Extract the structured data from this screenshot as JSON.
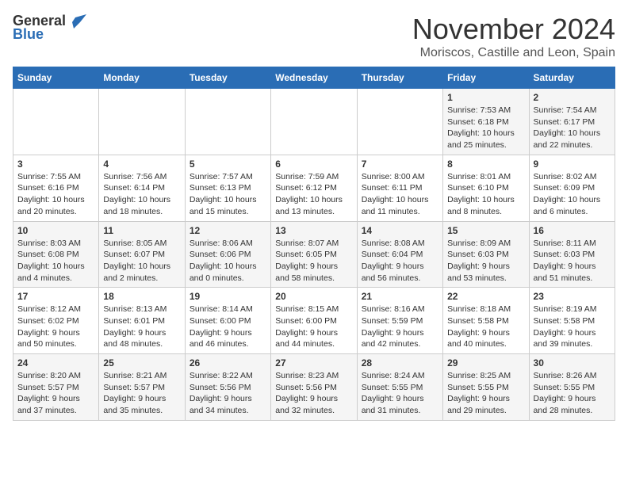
{
  "header": {
    "logo_general": "General",
    "logo_blue": "Blue",
    "month": "November 2024",
    "location": "Moriscos, Castille and Leon, Spain"
  },
  "days_of_week": [
    "Sunday",
    "Monday",
    "Tuesday",
    "Wednesday",
    "Thursday",
    "Friday",
    "Saturday"
  ],
  "weeks": [
    [
      {
        "day": "",
        "info": ""
      },
      {
        "day": "",
        "info": ""
      },
      {
        "day": "",
        "info": ""
      },
      {
        "day": "",
        "info": ""
      },
      {
        "day": "",
        "info": ""
      },
      {
        "day": "1",
        "info": "Sunrise: 7:53 AM\nSunset: 6:18 PM\nDaylight: 10 hours and 25 minutes."
      },
      {
        "day": "2",
        "info": "Sunrise: 7:54 AM\nSunset: 6:17 PM\nDaylight: 10 hours and 22 minutes."
      }
    ],
    [
      {
        "day": "3",
        "info": "Sunrise: 7:55 AM\nSunset: 6:16 PM\nDaylight: 10 hours and 20 minutes."
      },
      {
        "day": "4",
        "info": "Sunrise: 7:56 AM\nSunset: 6:14 PM\nDaylight: 10 hours and 18 minutes."
      },
      {
        "day": "5",
        "info": "Sunrise: 7:57 AM\nSunset: 6:13 PM\nDaylight: 10 hours and 15 minutes."
      },
      {
        "day": "6",
        "info": "Sunrise: 7:59 AM\nSunset: 6:12 PM\nDaylight: 10 hours and 13 minutes."
      },
      {
        "day": "7",
        "info": "Sunrise: 8:00 AM\nSunset: 6:11 PM\nDaylight: 10 hours and 11 minutes."
      },
      {
        "day": "8",
        "info": "Sunrise: 8:01 AM\nSunset: 6:10 PM\nDaylight: 10 hours and 8 minutes."
      },
      {
        "day": "9",
        "info": "Sunrise: 8:02 AM\nSunset: 6:09 PM\nDaylight: 10 hours and 6 minutes."
      }
    ],
    [
      {
        "day": "10",
        "info": "Sunrise: 8:03 AM\nSunset: 6:08 PM\nDaylight: 10 hours and 4 minutes."
      },
      {
        "day": "11",
        "info": "Sunrise: 8:05 AM\nSunset: 6:07 PM\nDaylight: 10 hours and 2 minutes."
      },
      {
        "day": "12",
        "info": "Sunrise: 8:06 AM\nSunset: 6:06 PM\nDaylight: 10 hours and 0 minutes."
      },
      {
        "day": "13",
        "info": "Sunrise: 8:07 AM\nSunset: 6:05 PM\nDaylight: 9 hours and 58 minutes."
      },
      {
        "day": "14",
        "info": "Sunrise: 8:08 AM\nSunset: 6:04 PM\nDaylight: 9 hours and 56 minutes."
      },
      {
        "day": "15",
        "info": "Sunrise: 8:09 AM\nSunset: 6:03 PM\nDaylight: 9 hours and 53 minutes."
      },
      {
        "day": "16",
        "info": "Sunrise: 8:11 AM\nSunset: 6:03 PM\nDaylight: 9 hours and 51 minutes."
      }
    ],
    [
      {
        "day": "17",
        "info": "Sunrise: 8:12 AM\nSunset: 6:02 PM\nDaylight: 9 hours and 50 minutes."
      },
      {
        "day": "18",
        "info": "Sunrise: 8:13 AM\nSunset: 6:01 PM\nDaylight: 9 hours and 48 minutes."
      },
      {
        "day": "19",
        "info": "Sunrise: 8:14 AM\nSunset: 6:00 PM\nDaylight: 9 hours and 46 minutes."
      },
      {
        "day": "20",
        "info": "Sunrise: 8:15 AM\nSunset: 6:00 PM\nDaylight: 9 hours and 44 minutes."
      },
      {
        "day": "21",
        "info": "Sunrise: 8:16 AM\nSunset: 5:59 PM\nDaylight: 9 hours and 42 minutes."
      },
      {
        "day": "22",
        "info": "Sunrise: 8:18 AM\nSunset: 5:58 PM\nDaylight: 9 hours and 40 minutes."
      },
      {
        "day": "23",
        "info": "Sunrise: 8:19 AM\nSunset: 5:58 PM\nDaylight: 9 hours and 39 minutes."
      }
    ],
    [
      {
        "day": "24",
        "info": "Sunrise: 8:20 AM\nSunset: 5:57 PM\nDaylight: 9 hours and 37 minutes."
      },
      {
        "day": "25",
        "info": "Sunrise: 8:21 AM\nSunset: 5:57 PM\nDaylight: 9 hours and 35 minutes."
      },
      {
        "day": "26",
        "info": "Sunrise: 8:22 AM\nSunset: 5:56 PM\nDaylight: 9 hours and 34 minutes."
      },
      {
        "day": "27",
        "info": "Sunrise: 8:23 AM\nSunset: 5:56 PM\nDaylight: 9 hours and 32 minutes."
      },
      {
        "day": "28",
        "info": "Sunrise: 8:24 AM\nSunset: 5:55 PM\nDaylight: 9 hours and 31 minutes."
      },
      {
        "day": "29",
        "info": "Sunrise: 8:25 AM\nSunset: 5:55 PM\nDaylight: 9 hours and 29 minutes."
      },
      {
        "day": "30",
        "info": "Sunrise: 8:26 AM\nSunset: 5:55 PM\nDaylight: 9 hours and 28 minutes."
      }
    ]
  ]
}
